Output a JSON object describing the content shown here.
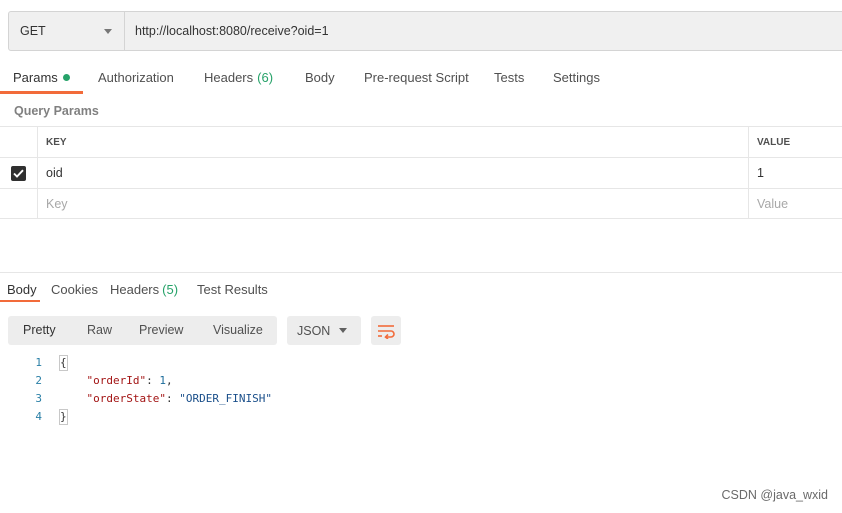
{
  "request": {
    "method": "GET",
    "url": "http://localhost:8080/receive?oid=1"
  },
  "request_tabs": [
    {
      "label": "Params",
      "count": "",
      "active": true,
      "has_dot": true
    },
    {
      "label": "Authorization",
      "count": ""
    },
    {
      "label": "Headers",
      "count": "(6)"
    },
    {
      "label": "Body",
      "count": ""
    },
    {
      "label": "Pre-request Script",
      "count": ""
    },
    {
      "label": "Tests",
      "count": ""
    },
    {
      "label": "Settings",
      "count": ""
    }
  ],
  "query_params": {
    "title": "Query Params",
    "headers": {
      "key": "KEY",
      "value": "VALUE"
    },
    "rows": [
      {
        "checked": true,
        "key": "oid",
        "value": "1"
      }
    ],
    "placeholder": {
      "key": "Key",
      "value": "Value"
    }
  },
  "response_tabs": [
    {
      "label": "Body",
      "count": "",
      "active": true
    },
    {
      "label": "Cookies",
      "count": ""
    },
    {
      "label": "Headers",
      "count": "(5)"
    },
    {
      "label": "Test Results",
      "count": ""
    }
  ],
  "view_options": [
    "Pretty",
    "Raw",
    "Preview",
    "Visualize"
  ],
  "format": "JSON",
  "code_lines": [
    "1",
    "2",
    "3",
    "4"
  ],
  "response_body": {
    "open": "{",
    "close": "}",
    "fields": [
      {
        "key": "\"orderId\"",
        "value": "1",
        "type": "number",
        "trail": ","
      },
      {
        "key": "\"orderState\"",
        "value": "\"ORDER_FINISH\"",
        "type": "string",
        "trail": ""
      }
    ]
  },
  "watermark": "CSDN @java_wxid",
  "colors": {
    "accent": "#f26b3a",
    "count_green": "#26a269"
  }
}
